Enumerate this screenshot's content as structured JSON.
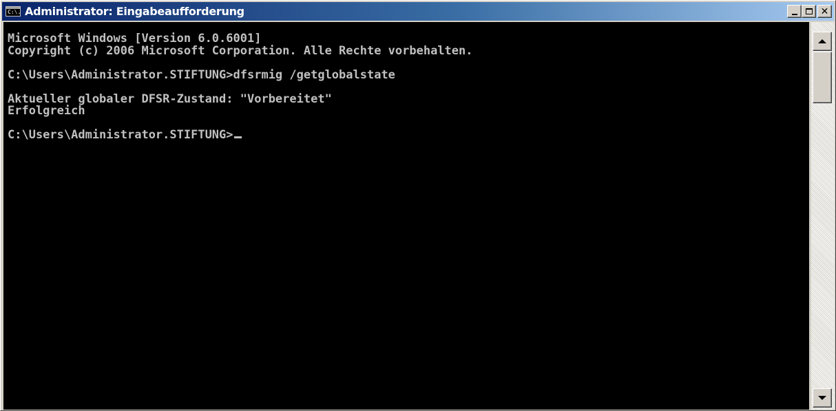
{
  "window": {
    "title": "Administrator: Eingabeaufforderung",
    "icon_text": "C:\\.",
    "icon": "cmd-icon"
  },
  "titlebar_buttons": {
    "minimize_icon": "minimize-icon",
    "maximize_icon": "maximize-icon",
    "close_icon": "close-icon",
    "close_glyph": "✕"
  },
  "console": {
    "lines": [
      "Microsoft Windows [Version 6.0.6001]",
      "Copyright (c) 2006 Microsoft Corporation. Alle Rechte vorbehalten.",
      "",
      "C:\\Users\\Administrator.STIFTUNG>dfsrmig /getglobalstate",
      "",
      "Aktueller globaler DFSR-Zustand: \"Vorbereitet\"",
      "Erfolgreich",
      "",
      "C:\\Users\\Administrator.STIFTUNG>"
    ],
    "text_color": "#c0c0c0",
    "background_color": "#000000"
  },
  "scrollbar": {
    "up_icon": "scroll-up-arrow-icon",
    "down_icon": "scroll-down-arrow-icon"
  },
  "colors": {
    "titlebar_start": "#0a246a",
    "titlebar_end": "#a6caf0",
    "chrome": "#d4d0c8"
  }
}
